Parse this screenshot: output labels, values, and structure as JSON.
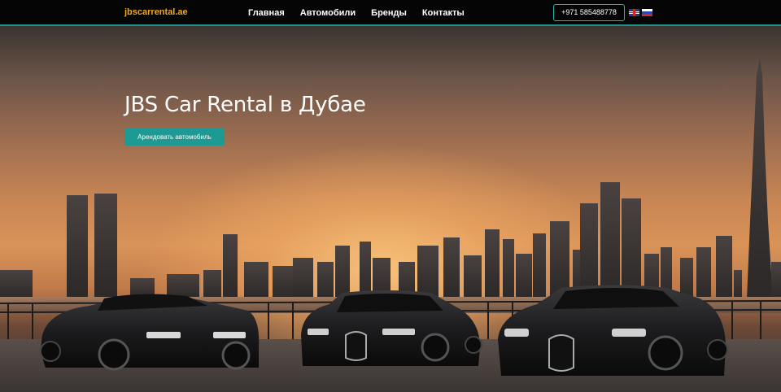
{
  "header": {
    "logo": "jbscarrental.ae",
    "nav": [
      "Главная",
      "Автомобили",
      "Бренды",
      "Контакты"
    ],
    "phone": "+971 585488778",
    "languages": [
      "english-flag-icon",
      "russian-flag-icon"
    ]
  },
  "hero": {
    "title": "JBS Car Rental в Дубае",
    "cta": "Арендовать автомобиль"
  },
  "colors": {
    "logo": "#f2a81f",
    "accent": "#1d9a93",
    "header_border": "#1f8f8b",
    "header_bg": "#050505"
  }
}
